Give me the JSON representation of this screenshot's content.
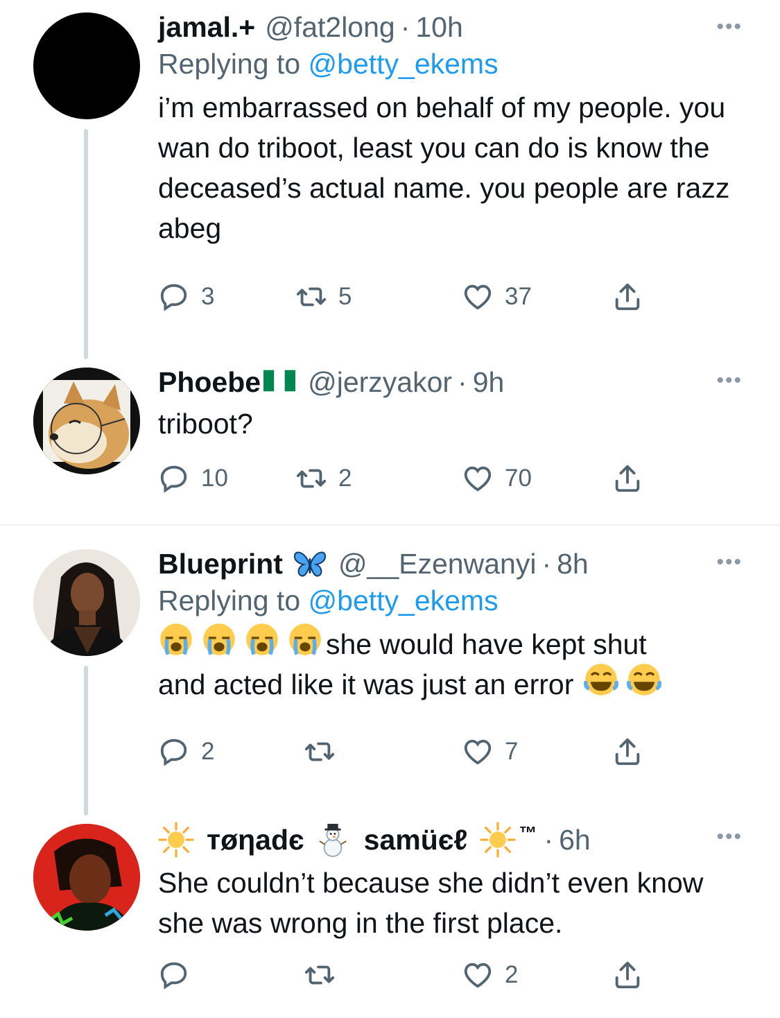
{
  "tweets": [
    {
      "name": "jamal.+",
      "handle": "@fat2long",
      "time": "10h",
      "replying_prefix": "Replying to ",
      "replying_to": "@betty_ekems",
      "text": "i’m embarrassed on behalf of my people. you wan do triboot, least you can do is know the deceased’s actual name. you people are razz abeg",
      "replies": "3",
      "retweets": "5",
      "likes": "37"
    },
    {
      "name": "Phoebe",
      "name_flag": "nigeria-flag",
      "handle": "@jerzyakor",
      "time": "9h",
      "text": "triboot?",
      "replies": "10",
      "retweets": "2",
      "likes": "70"
    },
    {
      "name": "Blueprint",
      "name_emoji": "butterfly-icon",
      "handle": "@__Ezenwanyi",
      "time": "8h",
      "replying_prefix": "Replying to ",
      "replying_to": "@betty_ekems",
      "text_line1": "she would have kept shut",
      "text_line2": "and acted like it was just an error",
      "replies": "2",
      "retweets": "",
      "likes": "7"
    },
    {
      "name_part1": "тøηadє",
      "name_part2": "samüєℓ",
      "name_suffix": "™",
      "time": "6h",
      "text": "She couldn’t because she didn’t even know she was wrong in the first place.",
      "replies": "",
      "retweets": "",
      "likes": "2"
    }
  ],
  "more_label": "•••",
  "dot": "·",
  "colors": {
    "link": "#1d9bf0",
    "meta": "#536471",
    "thread": "#cfd9de"
  }
}
